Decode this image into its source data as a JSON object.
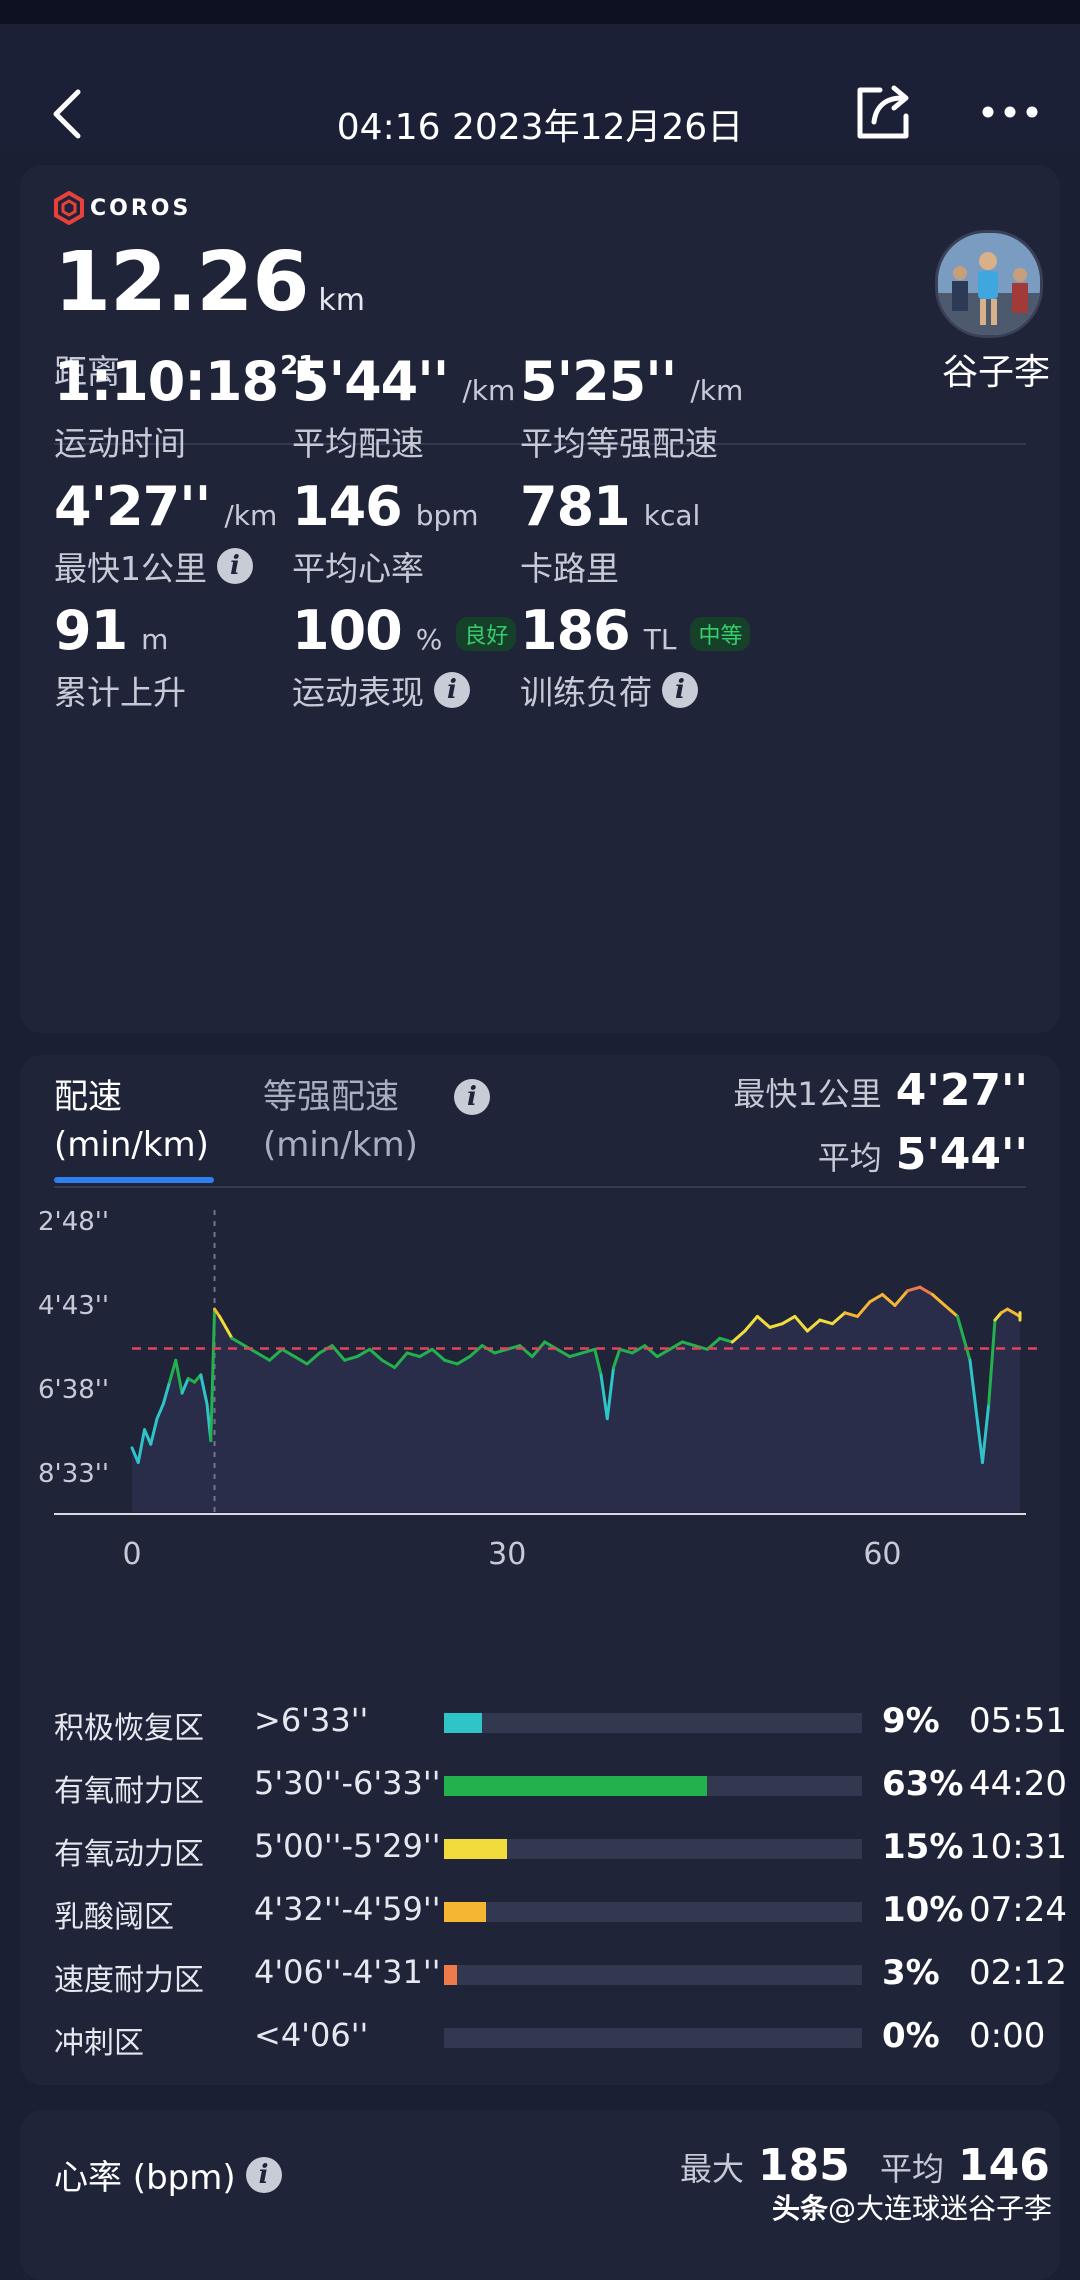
{
  "header": {
    "datetime": "04:16 2023年12月26日"
  },
  "summary": {
    "brand": "COROS",
    "distance": "12.26",
    "distance_unit": "km",
    "distance_label": "距离",
    "username": "谷子李"
  },
  "stats": [
    {
      "value": "1:10:18",
      "sup": "21",
      "unit": "",
      "label": "运动时间",
      "info": false,
      "badge": ""
    },
    {
      "value": "5'44''",
      "sup": "",
      "unit": "/km",
      "label": "平均配速",
      "info": false,
      "badge": ""
    },
    {
      "value": "5'25''",
      "sup": "",
      "unit": "/km",
      "label": "平均等强配速",
      "info": false,
      "badge": ""
    },
    {
      "value": "4'27''",
      "sup": "",
      "unit": "/km",
      "label": "最快1公里",
      "info": true,
      "badge": ""
    },
    {
      "value": "146",
      "sup": "",
      "unit": "bpm",
      "label": "平均心率",
      "info": false,
      "badge": ""
    },
    {
      "value": "781",
      "sup": "",
      "unit": "kcal",
      "label": "卡路里",
      "info": false,
      "badge": ""
    },
    {
      "value": "91",
      "sup": "",
      "unit": "m",
      "label": "累计上升",
      "info": false,
      "badge": ""
    },
    {
      "value": "100",
      "sup": "",
      "unit": "%",
      "label": "运动表现",
      "info": true,
      "badge": "良好"
    },
    {
      "value": "186",
      "sup": "",
      "unit": "TL",
      "label": "训练负荷",
      "info": true,
      "badge": "中等"
    }
  ],
  "pace": {
    "tab1_line1": "配速",
    "tab1_line2": "(min/km)",
    "tab2_line1": "等强配速",
    "tab2_line2": "(min/km)",
    "fastest_label": "最快1公里",
    "fastest_value": "4'27''",
    "avg_label": "平均",
    "avg_value": "5'44''"
  },
  "chart_data": {
    "type": "line",
    "title": "",
    "xlabel": "",
    "ylabel": "",
    "x_ticks": [
      0,
      30,
      60
    ],
    "y_ticks": [
      "2'48''",
      "4'43''",
      "6'38''",
      "8'33''"
    ],
    "y_tick_seconds": [
      168,
      283,
      398,
      513
    ],
    "ylim_seconds": [
      168,
      513
    ],
    "y_inverted": true,
    "xlim": [
      0,
      71
    ],
    "average_seconds": 344,
    "average_line_color": "#e0455a",
    "fill_color": "#2a2f4d",
    "series": [
      {
        "x": [
          0,
          0.5,
          1,
          1.5,
          2,
          2.5,
          3,
          3.5,
          4,
          4.5,
          5,
          5.5,
          6,
          6.3,
          6.6,
          7,
          7.5,
          8,
          9,
          10,
          11,
          12,
          13,
          14,
          15,
          16,
          17,
          18,
          19,
          20,
          21,
          22,
          23,
          24,
          25,
          26,
          27,
          28,
          29,
          30,
          31,
          32,
          33,
          34,
          35,
          36,
          37,
          37.5,
          38,
          38.5,
          39,
          40,
          41,
          42,
          43,
          44,
          45,
          46,
          47,
          48,
          49,
          50,
          51,
          52,
          53,
          54,
          55,
          56,
          57,
          58,
          59,
          60,
          61,
          62,
          63,
          64,
          65,
          66,
          67,
          68,
          68.5,
          69,
          69.5,
          70,
          71,
          72,
          73
        ],
        "y": [
          480,
          500,
          455,
          475,
          440,
          420,
          390,
          360,
          405,
          385,
          390,
          380,
          420,
          470,
          290,
          300,
          315,
          330,
          340,
          350,
          360,
          345,
          355,
          365,
          350,
          340,
          360,
          355,
          345,
          360,
          370,
          350,
          355,
          345,
          360,
          365,
          355,
          340,
          350,
          345,
          340,
          355,
          335,
          345,
          355,
          350,
          345,
          380,
          440,
          370,
          345,
          350,
          340,
          355,
          345,
          335,
          340,
          345,
          330,
          335,
          320,
          300,
          315,
          310,
          300,
          320,
          305,
          310,
          295,
          300,
          280,
          270,
          285,
          265,
          260,
          270,
          285,
          300,
          360,
          500,
          420,
          305,
          295,
          290,
          300,
          295,
          305
        ]
      }
    ]
  },
  "zones": [
    {
      "name": "积极恢复区",
      "range": ">6'33''",
      "pct": "9%",
      "time": "05:51",
      "fraction": 0.09,
      "color": "#2ec4c8"
    },
    {
      "name": "有氧耐力区",
      "range": "5'30''-6'33''",
      "pct": "63%",
      "time": "44:20",
      "fraction": 0.63,
      "color": "#22b14c"
    },
    {
      "name": "有氧动力区",
      "range": "5'00''-5'29''",
      "pct": "15%",
      "time": "10:31",
      "fraction": 0.15,
      "color": "#f2dc3d"
    },
    {
      "name": "乳酸阈区",
      "range": "4'32''-4'59''",
      "pct": "10%",
      "time": "07:24",
      "fraction": 0.1,
      "color": "#f5b731"
    },
    {
      "name": "速度耐力区",
      "range": "4'06''-4'31''",
      "pct": "3%",
      "time": "02:12",
      "fraction": 0.03,
      "color": "#ef7a4a"
    },
    {
      "name": "冲刺区",
      "range": "<4'06''",
      "pct": "0%",
      "time": "0:00",
      "fraction": 0.0,
      "color": "#e04848"
    }
  ],
  "heart_rate": {
    "title": "心率 (bpm)",
    "max_label": "最大",
    "max_value": "185",
    "avg_label": "平均",
    "avg_value": "146"
  },
  "watermark": {
    "bold": "头条",
    "text": "@大连球迷谷子李"
  }
}
